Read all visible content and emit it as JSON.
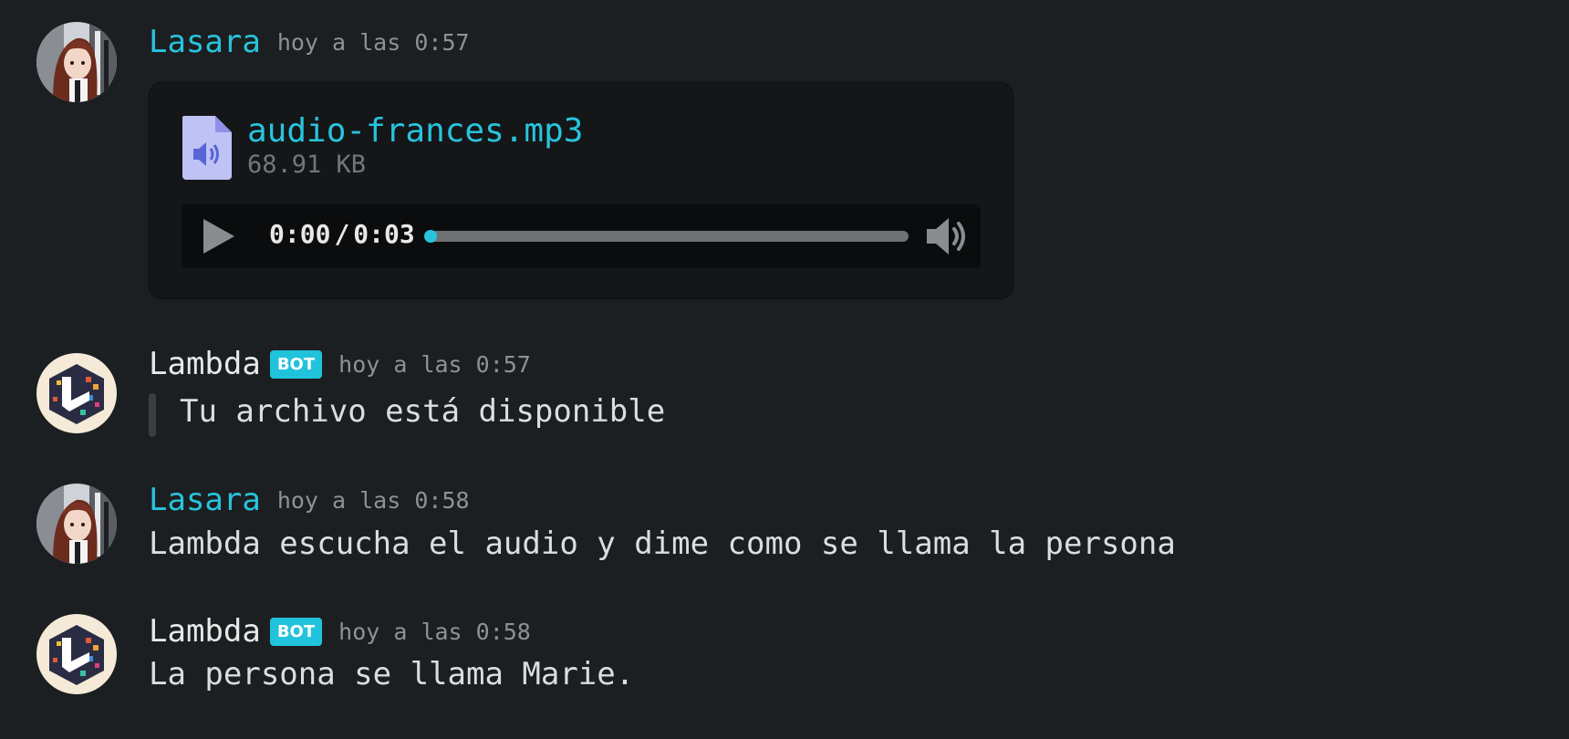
{
  "messages": [
    {
      "author": "Lasara",
      "timestamp": "hoy a las 0:57",
      "attachment": {
        "file_name": "audio-frances.mp3",
        "file_size": "68.91 KB",
        "current_time": "0:00",
        "separator": "/",
        "duration": "0:03",
        "progress": 0
      }
    },
    {
      "author": "Lambda",
      "badge": "BOT",
      "timestamp": "hoy a las 0:57",
      "text": "Tu archivo está disponible"
    },
    {
      "author": "Lasara",
      "timestamp": "hoy a las 0:58",
      "text": "Lambda escucha el audio y dime como se llama la persona"
    },
    {
      "author": "Lambda",
      "badge": "BOT",
      "timestamp": "hoy a las 0:58",
      "text": "La persona se llama Marie."
    }
  ],
  "icons": {
    "file": "audio-file-icon",
    "play": "play-icon",
    "volume": "volume-icon"
  },
  "colors": {
    "background": "#1c1f21",
    "accent": "#28c4dd",
    "username_user": "#28c4dd",
    "bot_badge": "#21c3dc",
    "file_icon": "#bfc2f5"
  }
}
